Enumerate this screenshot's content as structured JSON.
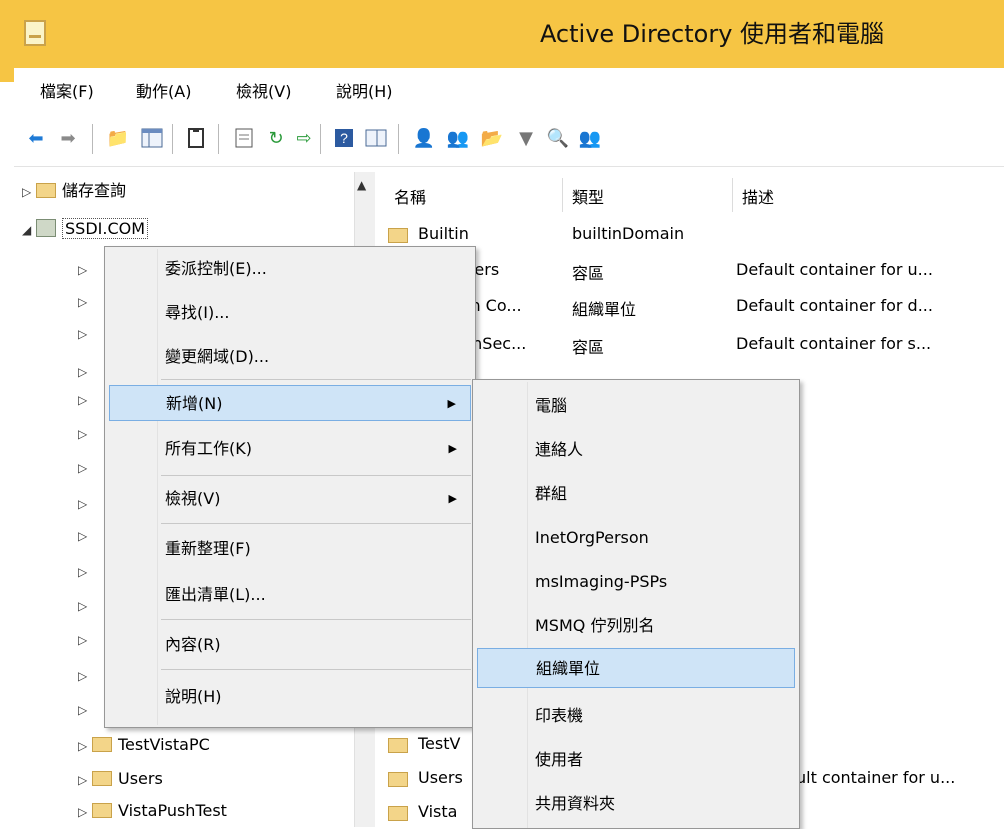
{
  "window": {
    "title": "Active Directory 使用者和電腦"
  },
  "menu": [
    "檔案(F)",
    "動作(A)",
    "檢視(V)",
    "說明(H)"
  ],
  "toolbar": {
    "icons": [
      "back-icon",
      "forward-icon",
      "up-folder-icon",
      "show-tree-icon",
      "copy-icon",
      "properties-icon",
      "refresh-icon",
      "export-icon",
      "help-icon",
      "console-tree-icon",
      "new-user-icon",
      "new-group-icon",
      "new-ou-icon",
      "filter-icon",
      "find-icon",
      "add-to-group-icon"
    ]
  },
  "tree": {
    "saved_queries": "儲存查詢",
    "domain": "SSDI.COM",
    "visible_children": [
      "TestVistaPC",
      "Users",
      "VistaPushTest"
    ]
  },
  "list": {
    "columns": [
      "名稱",
      "類型",
      "描述"
    ],
    "rows": [
      {
        "name": "Builtin",
        "type": "builtinDomain",
        "desc": ""
      },
      {
        "name": "uters",
        "type": "容區",
        "desc": "Default container for u..."
      },
      {
        "name": "in Co...",
        "type": "組織單位",
        "desc": "Default container for d..."
      },
      {
        "name": "gnSec...",
        "type": "容區",
        "desc": "Default container for s..."
      },
      {
        "name": "TestV",
        "type": "",
        "desc": ""
      },
      {
        "name": "Users",
        "type": "",
        "desc": "ult container for u..."
      },
      {
        "name": "Vista",
        "type": "",
        "desc": ""
      }
    ]
  },
  "context_menu": {
    "items": [
      "委派控制(E)...",
      "尋找(I)...",
      "變更網域(D)...",
      "新增(N)",
      "所有工作(K)",
      "檢視(V)",
      "重新整理(F)",
      "匯出清單(L)...",
      "內容(R)",
      "說明(H)"
    ]
  },
  "submenu": {
    "items": [
      "電腦",
      "連絡人",
      "群組",
      "InetOrgPerson",
      "msImaging-PSPs",
      "MSMQ 佇列別名",
      "組織單位",
      "印表機",
      "使用者",
      "共用資料夾"
    ],
    "highlighted": "組織單位"
  }
}
